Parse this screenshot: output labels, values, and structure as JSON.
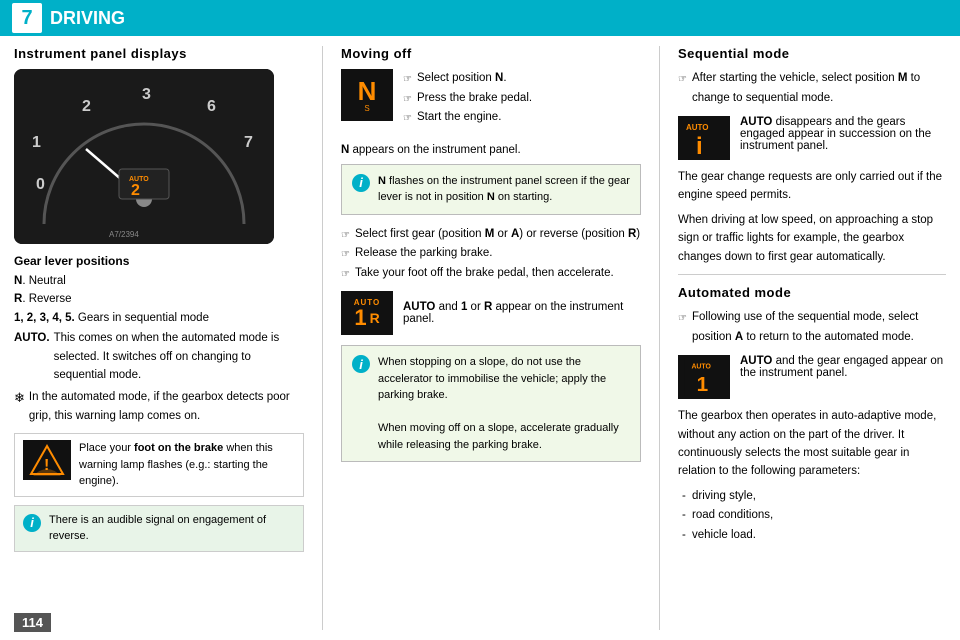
{
  "header": {
    "tab_number": "7",
    "title": "DRIVING"
  },
  "left_column": {
    "section_title": "Instrument panel displays",
    "gear_lever": {
      "title": "Gear lever positions",
      "items": [
        {
          "key": "N",
          "label": "Neutral"
        },
        {
          "key": "R",
          "label": "Reverse"
        },
        {
          "key": "1, 2, 3, 4, 5",
          "label": "Gears in sequential mode"
        },
        {
          "key": "AUTO.",
          "label": "This comes on when the automated mode is selected. It switches off on changing to sequential mode."
        }
      ]
    },
    "snow_note": "In the automated mode, if the gearbox detects poor grip, this warning lamp comes on.",
    "warning_box": {
      "instruction": "Place your foot on the brake when this warning lamp flashes (e.g.: starting the engine)."
    },
    "info_box": {
      "text": "There is an audible signal on engagement of reverse."
    }
  },
  "mid_column": {
    "section_title": "Moving off",
    "steps": [
      "Select position N.",
      "Press the brake pedal.",
      "Start the engine."
    ],
    "n_appears": "N appears on the instrument panel.",
    "info_panel_1": {
      "text": "N flashes on the instrument panel screen if the gear lever is not in position N on starting."
    },
    "steps2": [
      "Select first gear (position M or A) or reverse (position R)",
      "Release the parking brake.",
      "Take your foot off the brake pedal, then accelerate."
    ],
    "auto_display": {
      "text": "AUTO and 1 or R appear on the instrument panel."
    },
    "info_panel_2": {
      "text": "When stopping on a slope, do not use the accelerator to immobilise the vehicle; apply the parking brake.\nWhen moving off on a slope, accelerate gradually while releasing the parking brake."
    }
  },
  "right_column": {
    "section_title": "Sequential mode",
    "seq_steps": [
      "After starting the vehicle, select position M to change to sequential mode."
    ],
    "auto_disappears": {
      "badge_top": "AUTO",
      "text": "AUTO disappears and the gears engaged appear in succession on the instrument panel."
    },
    "gear_change_note": "The gear change requests are only carried out if the engine speed permits.",
    "low_speed_note": "When driving at low speed, on approaching a stop sign or traffic lights for example, the gearbox changes down to first gear automatically.",
    "auto_mode_title": "Automated mode",
    "auto_mode_steps": [
      "Following use of the sequential mode, select position A to return to the automated mode."
    ],
    "auto_engaged": {
      "badge_top": "AUTO",
      "text": "AUTO and the gear engaged appear on the instrument panel."
    },
    "gearbox_adapt": "The gearbox then operates in auto-adaptive mode, without any action on the part of the driver. It continuously selects the most suitable gear in relation to the following parameters:",
    "adapt_list": [
      "driving style,",
      "road conditions,",
      "vehicle load."
    ]
  },
  "page_number": "114"
}
